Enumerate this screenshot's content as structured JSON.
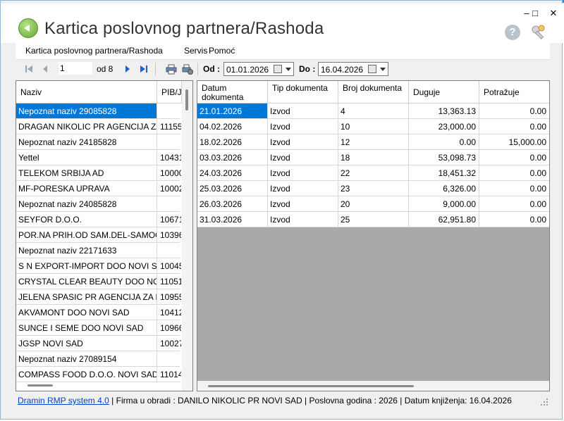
{
  "window": {
    "title": "Kartica poslovnog partnera/Rashoda",
    "minimize": "–",
    "maximize": "□",
    "close": "✕"
  },
  "menu": [
    "Kartica poslovnog partnera/Rashoda",
    "Servis",
    "Pomoć"
  ],
  "toolbar": {
    "position": "1",
    "of_label": "od 8",
    "from_label": "Od :",
    "from_date": "01.01.2026",
    "to_label": "Do :",
    "to_date": "16.04.2026"
  },
  "partners": {
    "columns": [
      "Naziv",
      "PIB/J"
    ],
    "rows": [
      {
        "name": "Nepoznat naziv 29085828",
        "pib": "",
        "selected": true
      },
      {
        "name": "DRAGAN NIKOLIC PR AGENCIJA ZA...",
        "pib": "11155"
      },
      {
        "name": "Nepoznat naziv 24185828",
        "pib": ""
      },
      {
        "name": "Yettel",
        "pib": "10431"
      },
      {
        "name": "TELEKOM SRBIJA AD",
        "pib": "10000"
      },
      {
        "name": "MF-PORESKA UPRAVA",
        "pib": "10002"
      },
      {
        "name": "Nepoznat naziv 24085828",
        "pib": ""
      },
      {
        "name": "SEYFOR D.O.O.",
        "pib": "10671"
      },
      {
        "name": "POR.NA PRIH.OD SAM.DEL-SAMOO...",
        "pib": "10396"
      },
      {
        "name": "Nepoznat naziv 22171633",
        "pib": ""
      },
      {
        "name": "S  N EXPORT-IMPORT DOO NOVI S...",
        "pib": "10045"
      },
      {
        "name": "CRYSTAL CLEAR BEAUTY DOO NO...",
        "pib": "11051"
      },
      {
        "name": "JELENA SPASIC PR AGENCIJA ZA K...",
        "pib": "10955"
      },
      {
        "name": "AKVAMONT DOO NOVI SAD",
        "pib": "10412"
      },
      {
        "name": "SUNCE I SEME DOO NOVI SAD",
        "pib": "10966"
      },
      {
        "name": "JGSP NOVI SAD",
        "pib": "10027"
      },
      {
        "name": "Nepoznat naziv 27089154",
        "pib": ""
      },
      {
        "name": "COMPASS FOOD D.O.O. NOVI SAD",
        "pib": "11014"
      }
    ]
  },
  "documents": {
    "columns": [
      "Datum dokumenta",
      "Tip dokumenta",
      "Broj dokumenta",
      "Duguje",
      "Potražuje"
    ],
    "rows": [
      {
        "date": "21.01.2026",
        "type": "Izvod",
        "number": "4",
        "debit": "13,363.13",
        "credit": "0.00",
        "selected": true
      },
      {
        "date": "04.02.2026",
        "type": "Izvod",
        "number": "10",
        "debit": "23,000.00",
        "credit": "0.00"
      },
      {
        "date": "18.02.2026",
        "type": "Izvod",
        "number": "12",
        "debit": "0.00",
        "credit": "15,000.00"
      },
      {
        "date": "03.03.2026",
        "type": "Izvod",
        "number": "18",
        "debit": "53,098.73",
        "credit": "0.00"
      },
      {
        "date": "24.03.2026",
        "type": "Izvod",
        "number": "22",
        "debit": "18,451.32",
        "credit": "0.00"
      },
      {
        "date": "25.03.2026",
        "type": "Izvod",
        "number": "23",
        "debit": "6,326.00",
        "credit": "0.00"
      },
      {
        "date": "26.03.2026",
        "type": "Izvod",
        "number": "20",
        "debit": "9,000.00",
        "credit": "0.00"
      },
      {
        "date": "31.03.2026",
        "type": "Izvod",
        "number": "25",
        "debit": "62,951.80",
        "credit": "0.00"
      }
    ]
  },
  "status": {
    "link": "Dramin RMP system 4.0",
    "firm": "Firma u obradi : DANILO NIKOLIC PR NOVI SAD",
    "year": "Poslovna godina : 2026",
    "posting_date": "Datum knjiženja: 16.04.2026",
    "separator": "|"
  },
  "colors": {
    "accent": "#1c8fd6",
    "selection": "#0078d7",
    "link": "#0044cc"
  }
}
